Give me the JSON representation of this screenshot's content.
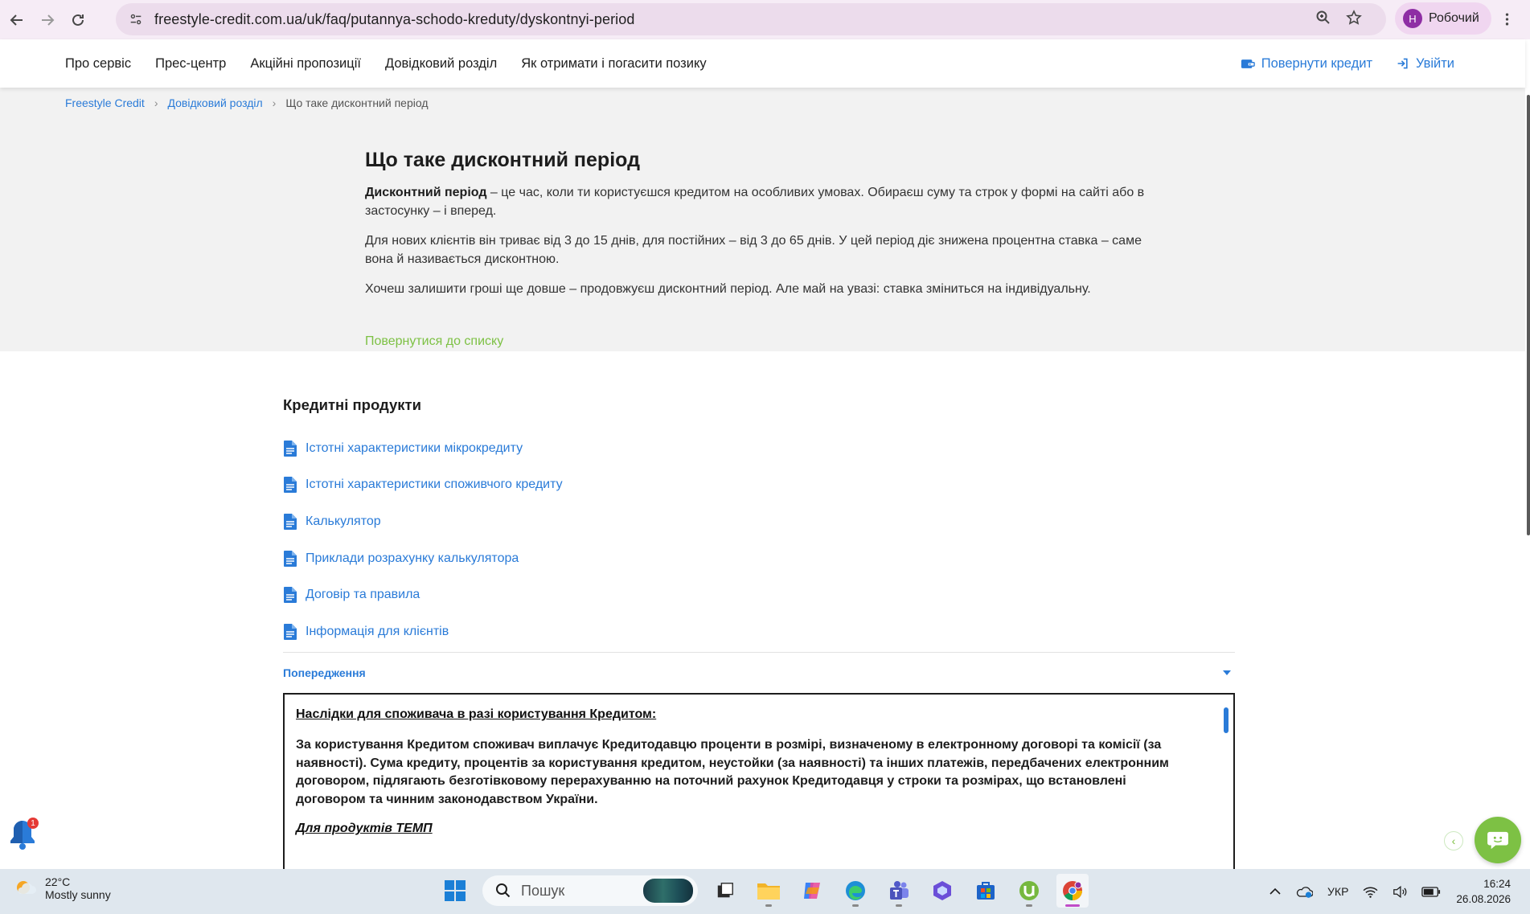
{
  "browser": {
    "url": "freestyle-credit.com.ua/uk/faq/putannya-schodo-kreduty/dyskontnyi-period",
    "profile_initial": "Н",
    "profile_name": "Робочий"
  },
  "header": {
    "nav": [
      "Про сервіс",
      "Прес-центр",
      "Акційні пропозиції",
      "Довідковий розділ",
      "Як отримати і погасити позику"
    ],
    "repay_label": "Повернути кредит",
    "login_label": "Увійти",
    "accent_color": "#2a7bd8"
  },
  "breadcrumb": [
    "Freestyle Credit",
    "Довідковий розділ",
    "Що таке дисконтний період"
  ],
  "article": {
    "title": "Що таке дисконтний період",
    "p1_bold": "Дисконтний період",
    "p1_rest": " – це час, коли ти користуєшся кредитом на особливих умовах. Обираєш суму та строк у формі на сайті або в застосунку – і вперед.",
    "p2": "Для нових клієнтів він триває від 3 до 15 днів, для постійних – від 3 до 65 днів. У цей період діє знижена процентна ставка – саме вона й називається дисконтною.",
    "p3": "Хочеш залишити гроші ще довше – продовжуєш дисконтний період. Але май на увазі: ставка зміниться на індивідуальну.",
    "back_link": "Повернутися до списку",
    "back_link_color": "#7dc144"
  },
  "products": {
    "title": "Кредитні продукти",
    "items": [
      "Істотні характеристики мікрокредиту",
      "Істотні характеристики споживчого кредиту",
      "Калькулятор",
      "Приклади розрахунку калькулятора",
      "Договір та правила",
      "Інформація для клієнтів"
    ]
  },
  "warnings": {
    "header": "Попередження",
    "box_title": "Наслідки для споживача в разі користування Кредитом:",
    "box_body": "За користування Кредитом споживач виплачує Кредитодавцю проценти в розмірі, визначеному в електронному договорі та комісії (за наявності). Сума кредиту, процентів за користування кредитом, неустойки (за наявності) та інших платежів, передбачених електронним договором, підлягають безготівковому перерахуванню на поточний рахунок Кредитодавця у строки та розмірах, що встановлені договором та чинним законодавством України.",
    "box_sub": "Для продуктів ТЕМП"
  },
  "widgets": {
    "bell_badge": "1"
  },
  "taskbar": {
    "weather_temp": "22°C",
    "weather_desc": "Mostly sunny",
    "search_placeholder": "Пошук",
    "lang": "УКР",
    "time": "16:24",
    "date": "26.08.2026"
  }
}
